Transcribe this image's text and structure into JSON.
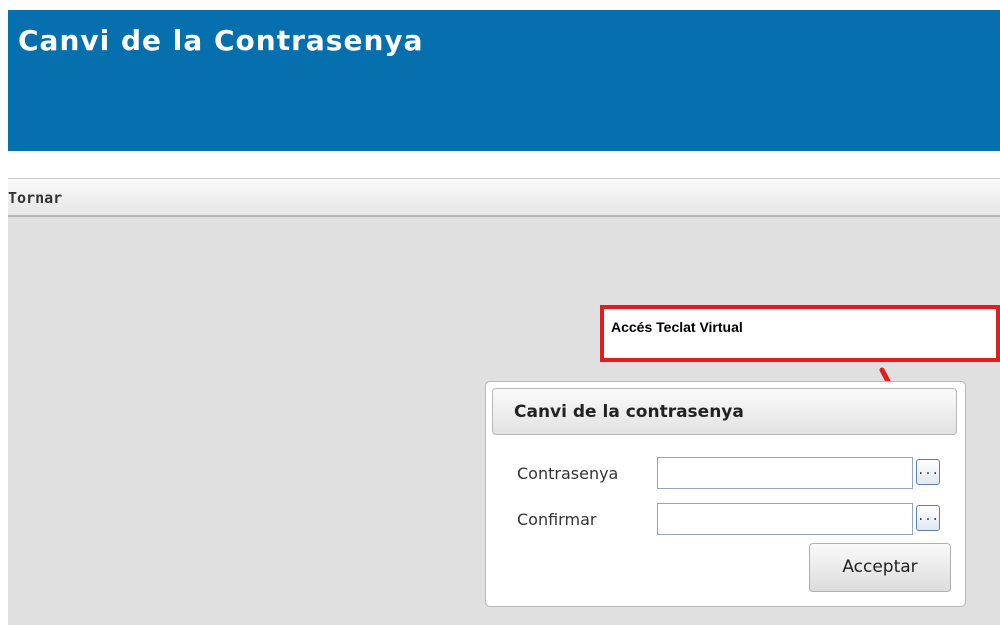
{
  "header": {
    "title": "Canvi de la Contrasenya"
  },
  "toolbar": {
    "back_label": "Tornar"
  },
  "callout": {
    "text": "Accés Teclat Virtual",
    "border_color": "#e31c1c"
  },
  "panel": {
    "title": "Canvi de la contrasenya",
    "fields": [
      {
        "label": "Contrasenya",
        "value": "",
        "button_label": "..."
      },
      {
        "label": "Confirmar",
        "value": "",
        "button_label": "..."
      }
    ],
    "submit_label": "Acceptar"
  },
  "colors": {
    "header_bg": "#0570ad",
    "content_bg": "#e0e0e0",
    "accent": "#e31c1c"
  },
  "icons": {
    "arrow": "red-pointer-arrow-icon"
  }
}
